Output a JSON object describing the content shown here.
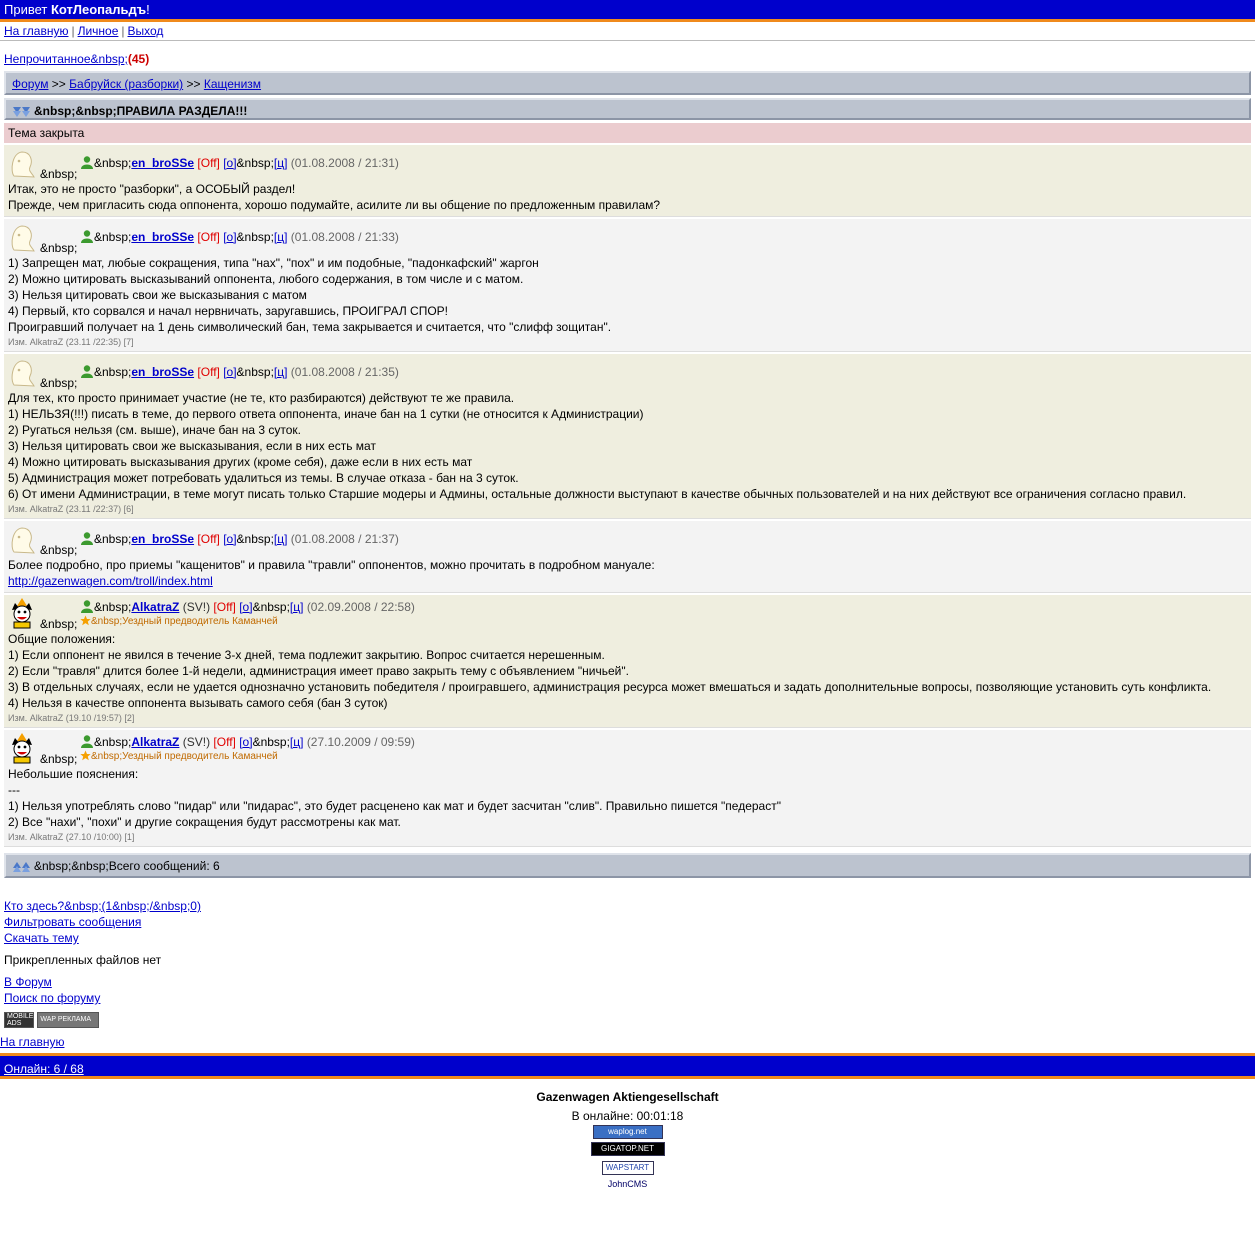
{
  "header": {
    "greeting_prefix": "Привет ",
    "username": "КотЛеопальдъ",
    "greeting_suffix": "!"
  },
  "menu": {
    "home": "На главную",
    "personal": "Личное",
    "exit": "Выход",
    "separator": "|"
  },
  "unread": {
    "label": "Непрочитанное&nbsp;",
    "count": "(45)"
  },
  "breadcrumb": {
    "forum": "Форум",
    "sep": ">>",
    "section": "Бабруйск (разборки)",
    "subsection": "Кащенизм"
  },
  "topic": {
    "prefix": "&nbsp;&nbsp;",
    "title": "ПРАВИЛА РАЗДЕЛА!!!",
    "closed": "Тема закрыта"
  },
  "common": {
    "nbsp": "&nbsp;",
    "nbsp_pre": "&nbsp;",
    "off": "[Off]",
    "o": "[о]",
    "ts": "[ц]"
  },
  "posts": [
    {
      "nick": "en_broSSe",
      "date": "(01.08.2008 / 21:31)",
      "lines": [
        "Итак, это не просто \"разборки\", а ОСОБЫЙ раздел!",
        "Прежде, чем пригласить сюда оппонента, хорошо подумайте, асилите ли вы общение по предложенным правилам?"
      ],
      "edit": ""
    },
    {
      "nick": "en_broSSe",
      "date": "(01.08.2008 / 21:33)",
      "lines": [
        "1) Запрещен мат, любые сокращения, типа \"нах\", \"пох\" и им подобные, \"падонкафский\" жаргон",
        "2) Можно цитировать высказываний оппонента, любого содержания, в том числе и с матом.",
        "3) Нельзя цитировать свои же высказывания с матом",
        "4) Первый, кто сорвался и начал нервничать, заругавшись, ПРОИГРАЛ СПОР!",
        "Проигравший получает на 1 день символический бан, тема закрывается и считается, что \"слифф зощитан\"."
      ],
      "edit": "Изм. AlkatraZ (23.11 /22:35) [7]"
    },
    {
      "nick": "en_broSSe",
      "date": "(01.08.2008 / 21:35)",
      "lines": [
        "Для тех, кто просто принимает участие (не те, кто разбираются) действуют те же правила.",
        "1) НЕЛЬЗЯ(!!!) писать в теме, до первого ответа оппонента, иначе бан на 1 сутки (не относится к Администрации)",
        "2) Ругаться нельзя (см. выше), иначе бан на 3 суток.",
        "3) Нельзя цитировать свои же высказывания, если в них есть мат",
        "4) Можно цитировать высказывания других (кроме себя), даже если в них есть мат",
        "5) Администрация может потребовать удалиться из темы. В случае отказа - бан на 3 суток.",
        "6) От имени Администрации, в теме могут писать только Старшие модеры и Админы, остальные должности выступают в качестве обычных пользователей и на них действуют все ограничения согласно правил."
      ],
      "edit": "Изм. AlkatraZ (23.11 /22:37) [6]"
    },
    {
      "nick": "en_broSSe",
      "date": "(01.08.2008 / 21:37)",
      "lines": [
        "Более подробно, про приемы \"кащенитов\" и правила \"травли\" оппонентов, можно прочитать в подробном мануале:"
      ],
      "link": "http://gazenwagen.com/troll/index.html",
      "edit": ""
    },
    {
      "nick": "AlkatraZ",
      "sv": "(SV!)",
      "date": "(02.09.2008 / 22:58)",
      "status": "&nbsp;Уездный предводитель Каманчей",
      "lines": [
        "Общие положения:",
        "1) Если оппонент не явился в течение 3-х дней, тема подлежит закрытию. Вопрос считается нерешенным.",
        "2) Если \"травля\" длится более 1-й недели, администрация имеет право закрыть тему с объявлением \"ничьей\".",
        "3) В отдельных случаях, если не удается однозначно установить победителя / проигравшего, администрация ресурса может вмешаться и задать дополнительные вопросы, позволяющие установить суть конфликта.",
        "4) Нельзя в качестве оппонента вызывать самого себя (бан 3 суток)"
      ],
      "edit": "Изм. AlkatraZ (19.10 /19:57) [2]"
    },
    {
      "nick": "AlkatraZ",
      "sv": "(SV!)",
      "date": "(27.10.2009 / 09:59)",
      "status": "&nbsp;Уездный предводитель Каманчей",
      "lines": [
        "Небольшие пояснения:",
        "---",
        "1) Нельзя употреблять слово \"пидар\" или \"пидарас\", это будет расценено как мат и будет засчитан \"слив\". Правильно пишется \"педераст\"",
        "2) Все \"нахи\", \"похи\" и другие сокращения будут рассмотрены как мат."
      ],
      "edit": "Изм. AlkatraZ (27.10 /10:00) [1]"
    }
  ],
  "total": {
    "prefix": "&nbsp;&nbsp;",
    "label": "Всего сообщений: 6"
  },
  "links": {
    "who": "Кто здесь?&nbsp;(1&nbsp;/&nbsp;0)",
    "filter": "Фильтровать сообщения",
    "download": "Скачать тему",
    "no_files": "Прикрепленных файлов нет",
    "to_forum": "В Форум",
    "search": "Поиск по форуму",
    "home": "На главную"
  },
  "banners": {
    "mobile": "MOBILE ADS",
    "wap": "WAP РЕКЛАМА"
  },
  "bottom": {
    "online": "Онлайн: 6 / 68"
  },
  "footer": {
    "company": "Gazenwagen Aktiengesellschaft",
    "online_time": "В онлайне: 00:01:18",
    "counter1": "waplog.net",
    "counter2": "GIGATOP.NET",
    "counter3": "WAPSTART",
    "engine": "JohnCMS"
  },
  "colors": {
    "topbar": "#0000cc",
    "accent": "#f08a1c",
    "closed": "#ebcccf",
    "post_a": "#efeedf",
    "post_b": "#f3f3f3",
    "bar": "#bcc3cf"
  }
}
